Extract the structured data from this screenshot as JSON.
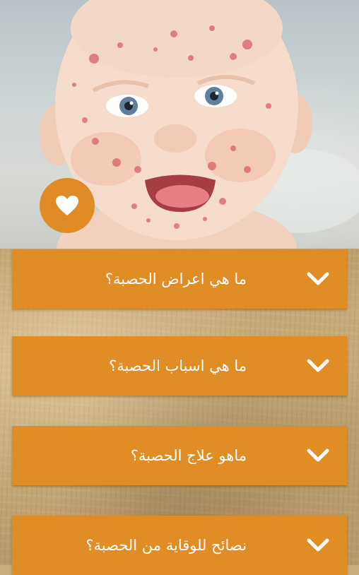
{
  "hero": {
    "image": "baby-with-measles-rash-photo"
  },
  "favorite": {
    "icon": "heart-icon"
  },
  "questions": [
    {
      "label": "ما هي اعراض الحصبة؟",
      "icon": "chevron-down-icon"
    },
    {
      "label": "ما هي اسباب الحصبة؟",
      "icon": "chevron-down-icon"
    },
    {
      "label": "ماهو علاج الحصبة؟",
      "icon": "chevron-down-icon"
    },
    {
      "label": "نصائح للوقاية من الحصبة؟",
      "icon": "chevron-down-icon"
    }
  ],
  "colors": {
    "accent": "#e08d26",
    "text": "#ffffff",
    "paper": "#c9ad7c"
  }
}
